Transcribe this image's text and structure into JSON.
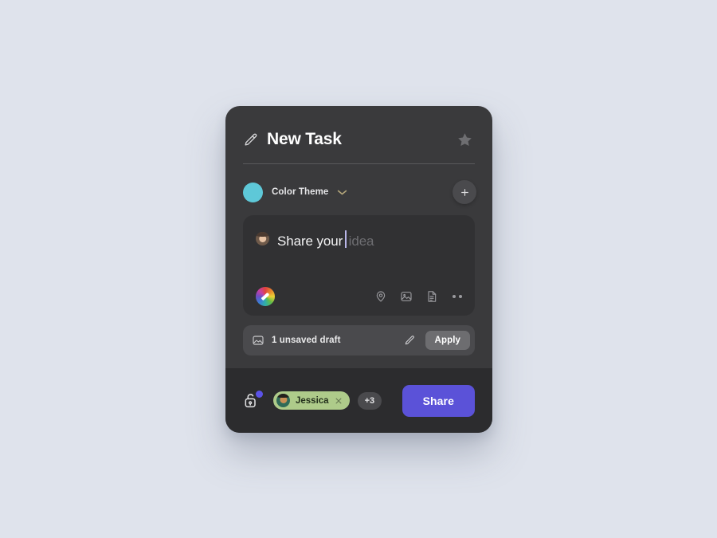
{
  "theme": {
    "page_background": "#dfe3ec",
    "card_background": "#3a3a3c",
    "footer_background": "#2c2c2e",
    "composer_background": "#313133",
    "accent_purple": "#5b52d8",
    "chip_green": "#aecb8a",
    "badge_blue": "#5b52e8",
    "avatar_ring": "#5ec8d8",
    "chevron_color": "#b3a57a"
  },
  "header": {
    "title": "New Task",
    "pencil_icon": "pencil-icon",
    "star_icon": "star-icon"
  },
  "theme_row": {
    "avatar": "user-avatar",
    "label": "Color Theme",
    "chevron_icon": "chevron-down-icon",
    "add_label": "+",
    "add_icon": "plus-icon"
  },
  "composer": {
    "avatar": "author-avatar",
    "typed_text": "Share your",
    "placeholder": "idea",
    "color_wheel_icon": "color-wheel-icon",
    "tools": [
      {
        "name": "location-pin-icon",
        "label": "Location"
      },
      {
        "name": "image-icon",
        "label": "Image"
      },
      {
        "name": "document-icon",
        "label": "Document"
      },
      {
        "name": "more-options-icon",
        "label": "More"
      }
    ]
  },
  "draft": {
    "icon": "image-placeholder-icon",
    "text": "1 unsaved draft",
    "edit_icon": "pencil-icon",
    "apply_label": "Apply"
  },
  "footer": {
    "lock_icon": "unlocked-padlock-icon",
    "lock_badge": "notification-dot",
    "person_chip": {
      "name": "Jessica",
      "avatar": "jessica-avatar",
      "remove_icon": "close-icon"
    },
    "more_people_label": "+3",
    "share_label": "Share"
  }
}
